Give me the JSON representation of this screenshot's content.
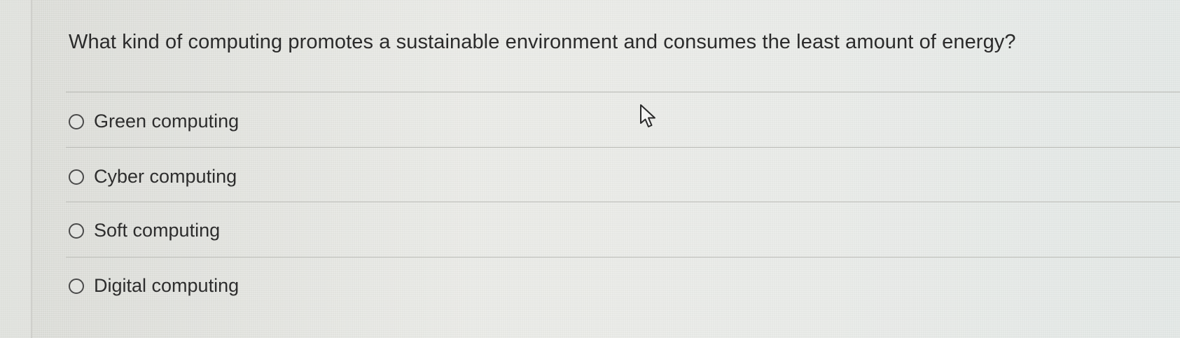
{
  "question": {
    "text": "What kind of computing promotes a sustainable environment and consumes the least amount of energy?"
  },
  "options": [
    {
      "label": "Green computing",
      "selected": false
    },
    {
      "label": "Cyber computing",
      "selected": false
    },
    {
      "label": "Soft computing",
      "selected": false
    },
    {
      "label": "Digital computing",
      "selected": false
    }
  ],
  "cursor": {
    "icon": "mouse-pointer-icon"
  }
}
